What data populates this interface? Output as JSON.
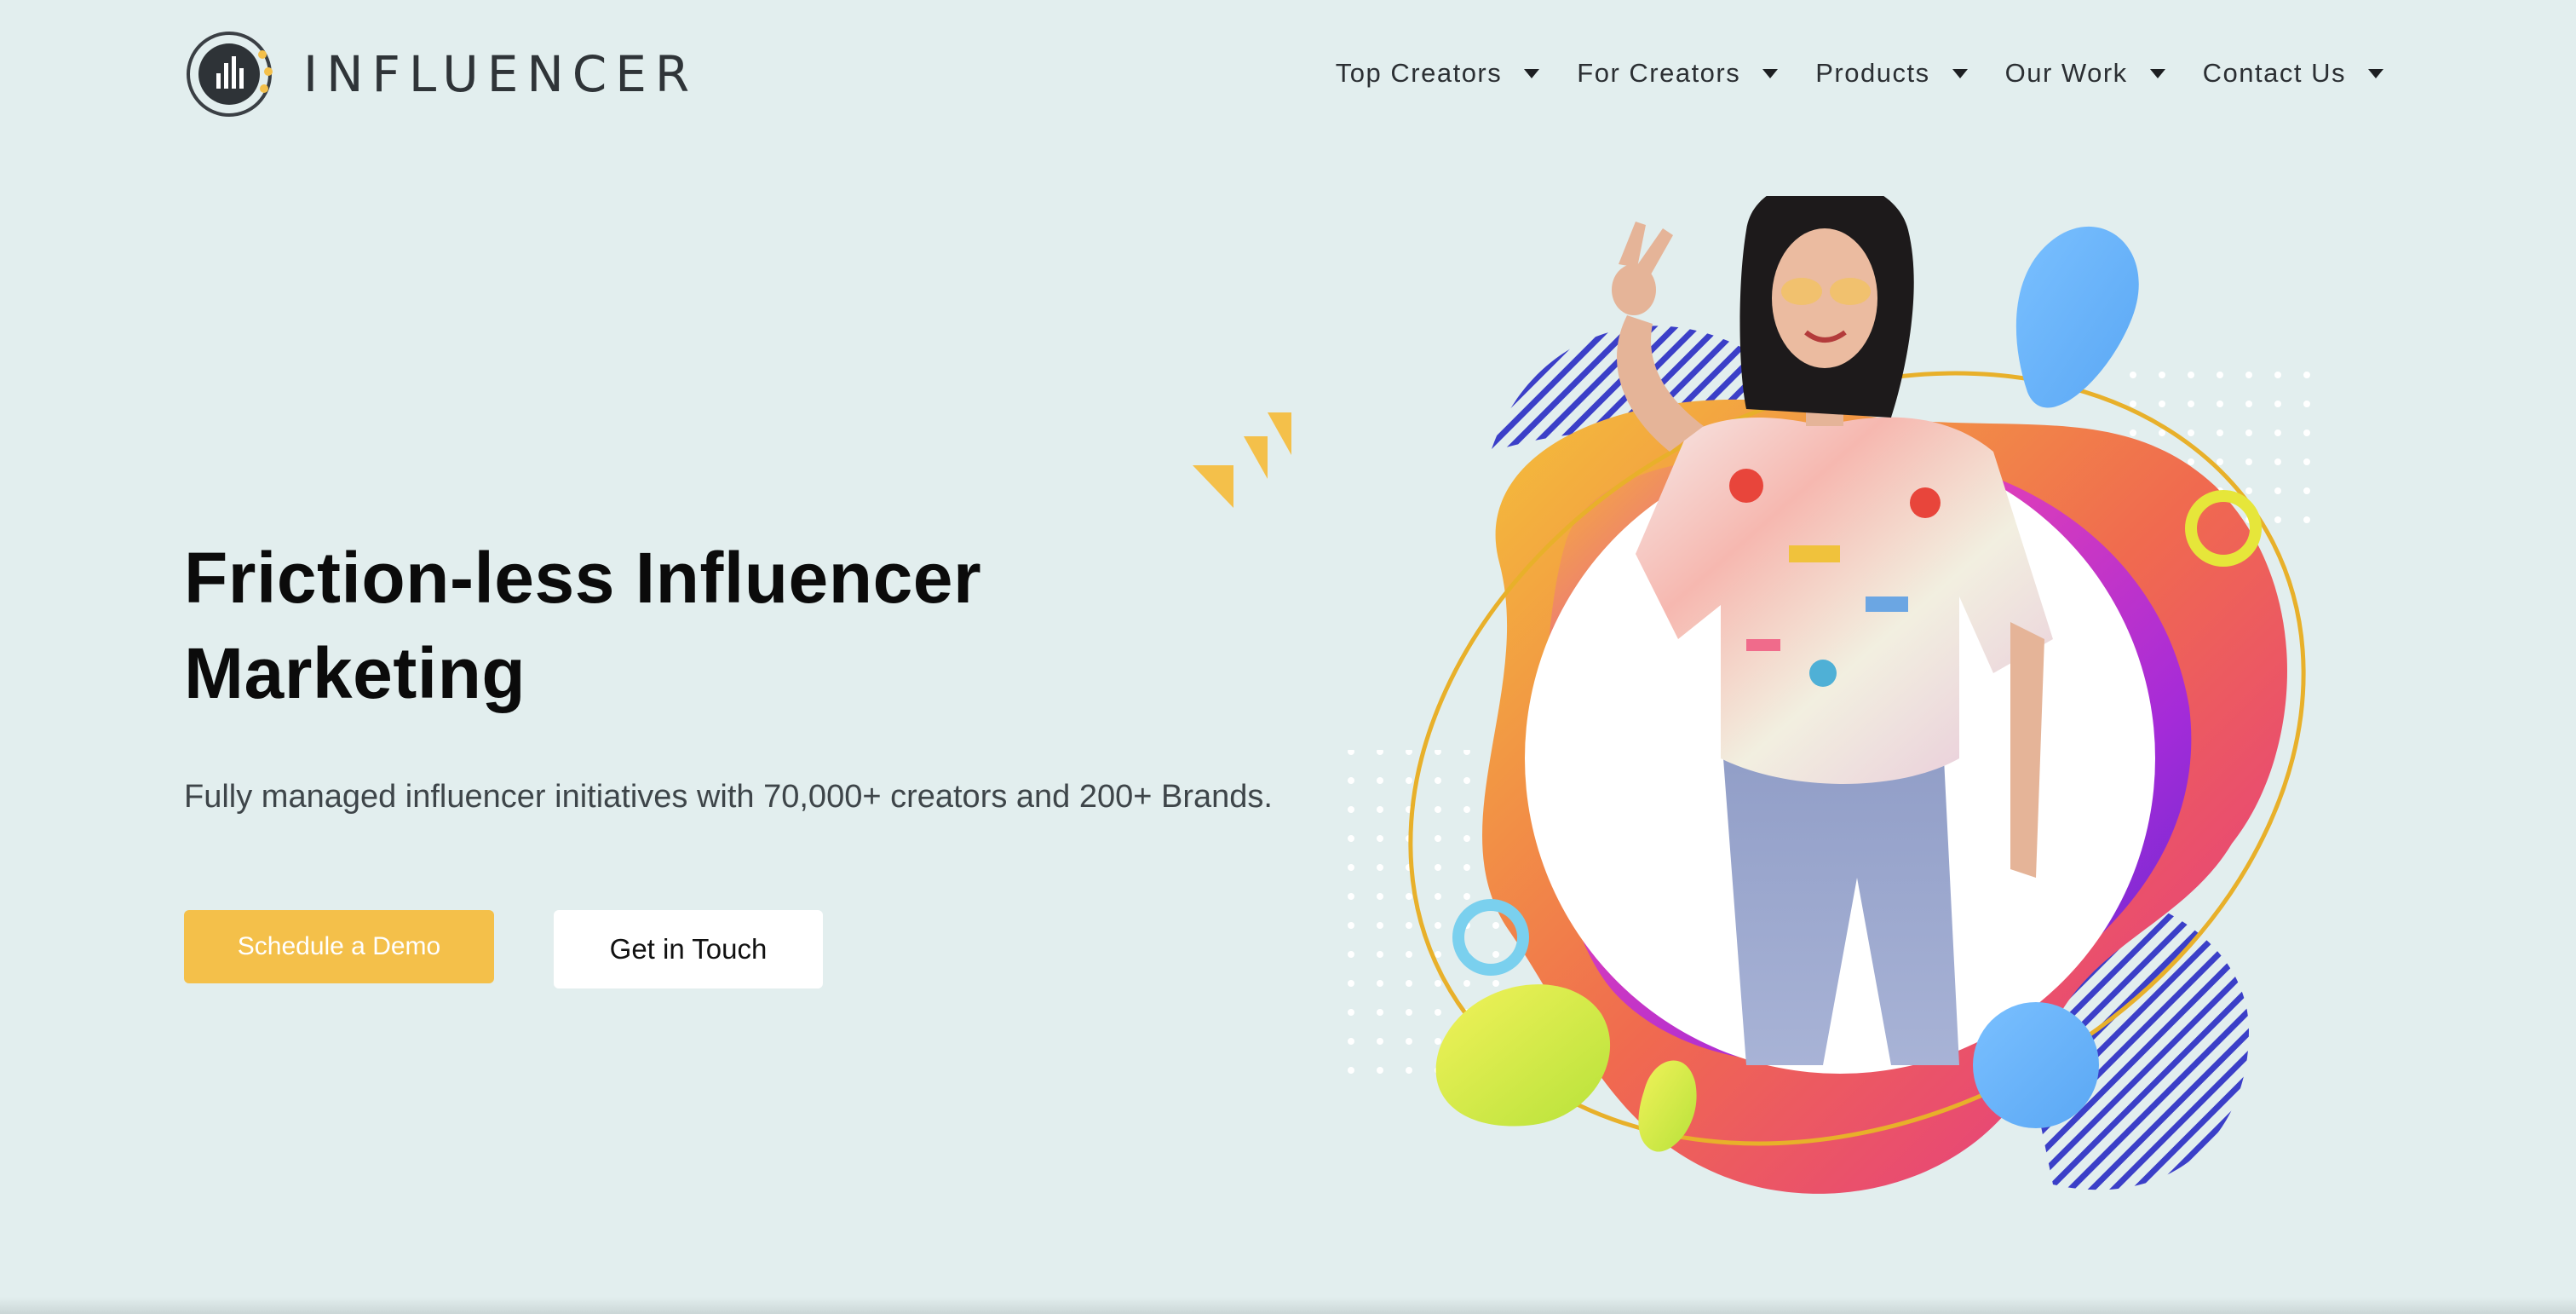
{
  "brand": {
    "name": "INFLUENCER",
    "logo_icon": "bar-chart-circle-icon",
    "colors": {
      "accent": "#f4c04a",
      "dark": "#2f3438",
      "background": "#e2eeee"
    }
  },
  "nav": {
    "items": [
      {
        "label": "Top Creators",
        "icon": "caret-down-icon"
      },
      {
        "label": "For Creators",
        "icon": "caret-down-icon"
      },
      {
        "label": "Products",
        "icon": "caret-down-icon"
      },
      {
        "label": "Our Work",
        "icon": "caret-down-icon"
      },
      {
        "label": "Contact Us",
        "icon": "caret-down-icon"
      }
    ]
  },
  "hero": {
    "title_line1": "Friction-less Influencer",
    "title_line2": "Marketing",
    "subtitle": "Fully managed influencer initiatives with 70,000+ creators and 200+ Brands.",
    "primary_button": "Schedule a Demo",
    "secondary_button": "Get in Touch",
    "decor_icon": "triple-chevron-icon",
    "illustration": "woman-peace-sign-with-colorful-shapes"
  }
}
